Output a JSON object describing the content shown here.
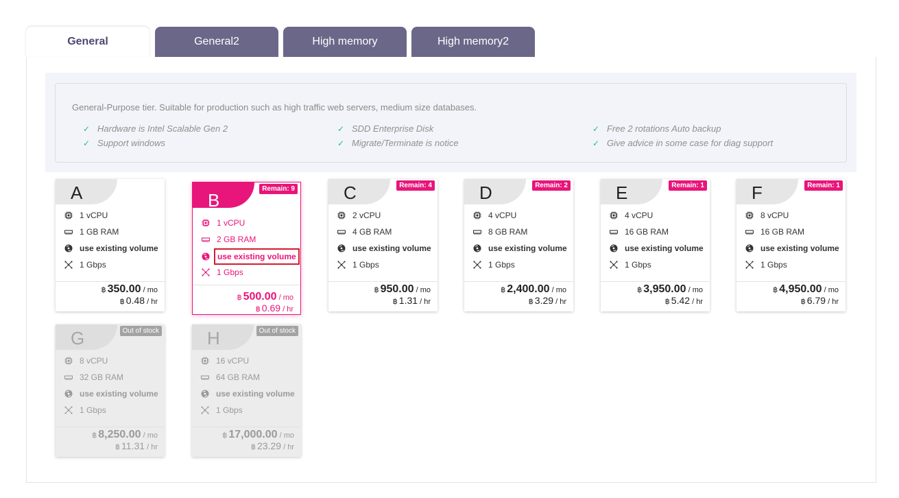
{
  "tabs": [
    {
      "label": "General",
      "active": true
    },
    {
      "label": "General2"
    },
    {
      "label": "High memory"
    },
    {
      "label": "High memory2"
    }
  ],
  "info": {
    "description": "General-Purpose tier. Suitable for production such as high traffic web servers, medium size databases.",
    "features": [
      "Hardware is Intel Scalable Gen 2",
      "Support windows",
      "SDD Enterprise Disk",
      "Migrate/Terminate is notice",
      "Free 2 rotations Auto backup",
      "Give advice in some case for diag support"
    ]
  },
  "currency": "฿",
  "units": {
    "mo": "/ mo",
    "hr": "/ hr"
  },
  "plans": [
    {
      "letter": "A",
      "badge": "",
      "cpu": "1 vCPU",
      "ram": "1 GB RAM",
      "volume": "use existing volume",
      "net": "1 Gbps",
      "price_mo": "350.00",
      "price_hr": "0.48"
    },
    {
      "letter": "B",
      "badge": "Remain: 9",
      "cpu": "1 vCPU",
      "ram": "2 GB RAM",
      "volume": "use existing volume",
      "net": "1 Gbps",
      "price_mo": "500.00",
      "price_hr": "0.69",
      "selected": true
    },
    {
      "letter": "C",
      "badge": "Remain: 4",
      "cpu": "2 vCPU",
      "ram": "4 GB RAM",
      "volume": "use existing volume",
      "net": "1 Gbps",
      "price_mo": "950.00",
      "price_hr": "1.31"
    },
    {
      "letter": "D",
      "badge": "Remain: 2",
      "cpu": "4 vCPU",
      "ram": "8 GB RAM",
      "volume": "use existing volume",
      "net": "1 Gbps",
      "price_mo": "2,400.00",
      "price_hr": "3.29"
    },
    {
      "letter": "E",
      "badge": "Remain: 1",
      "cpu": "4 vCPU",
      "ram": "16 GB RAM",
      "volume": "use existing volume",
      "net": "1 Gbps",
      "price_mo": "3,950.00",
      "price_hr": "5.42"
    },
    {
      "letter": "F",
      "badge": "Remain: 1",
      "cpu": "8 vCPU",
      "ram": "16 GB RAM",
      "volume": "use existing volume",
      "net": "1 Gbps",
      "price_mo": "4,950.00",
      "price_hr": "6.79"
    },
    {
      "letter": "G",
      "badge": "Out of stock",
      "cpu": "8 vCPU",
      "ram": "32 GB RAM",
      "volume": "use existing volume",
      "net": "1 Gbps",
      "price_mo": "8,250.00",
      "price_hr": "11.31",
      "out_of_stock": true
    },
    {
      "letter": "H",
      "badge": "Out of stock",
      "cpu": "16 vCPU",
      "ram": "64 GB RAM",
      "volume": "use existing volume",
      "net": "1 Gbps",
      "price_mo": "17,000.00",
      "price_hr": "23.29",
      "out_of_stock": true
    }
  ],
  "colors": {
    "accent": "#e8157a",
    "tab": "#6b6789",
    "check": "#2bb598",
    "highlight_box": "#d21b2e"
  }
}
